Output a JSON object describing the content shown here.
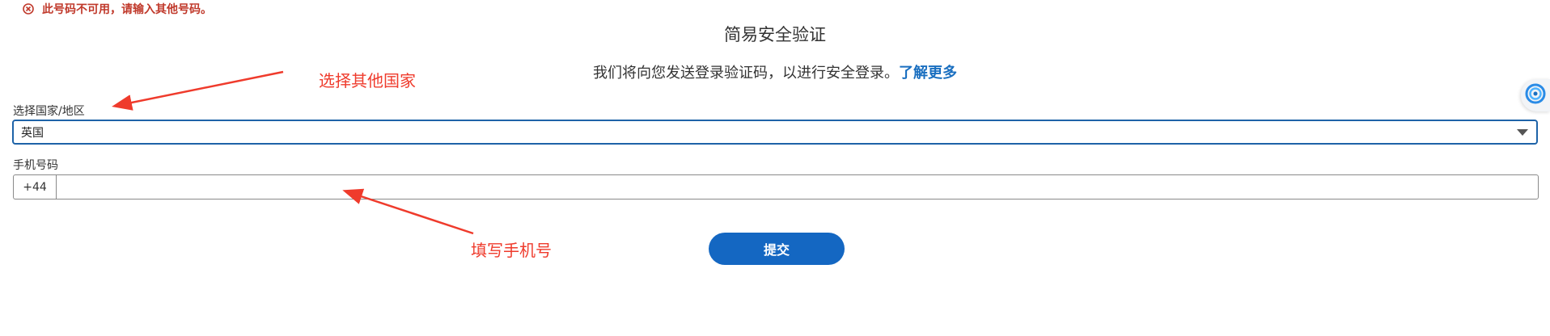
{
  "error": {
    "icon": "error-circle-icon",
    "message": "此号码不可用，请输入其他号码。",
    "color": "#c0392b"
  },
  "header": {
    "title": "简易安全验证",
    "subtitle": "我们将向您发送登录验证码，以进行安全登录。",
    "learn_more": "了解更多"
  },
  "form": {
    "country_label": "选择国家/地区",
    "country_value": "英国",
    "phone_label": "手机号码",
    "phone_prefix": "+44",
    "phone_value": "",
    "submit_label": "提交"
  },
  "annotations": {
    "country_note": "选择其他国家",
    "phone_note": "填写手机号",
    "color": "#ef3b2c"
  },
  "side_widget": {
    "icon": "swirl-app-icon"
  },
  "colors": {
    "primary": "#1467c2",
    "link": "#1a6fc0",
    "select_border": "#1e63a8"
  }
}
